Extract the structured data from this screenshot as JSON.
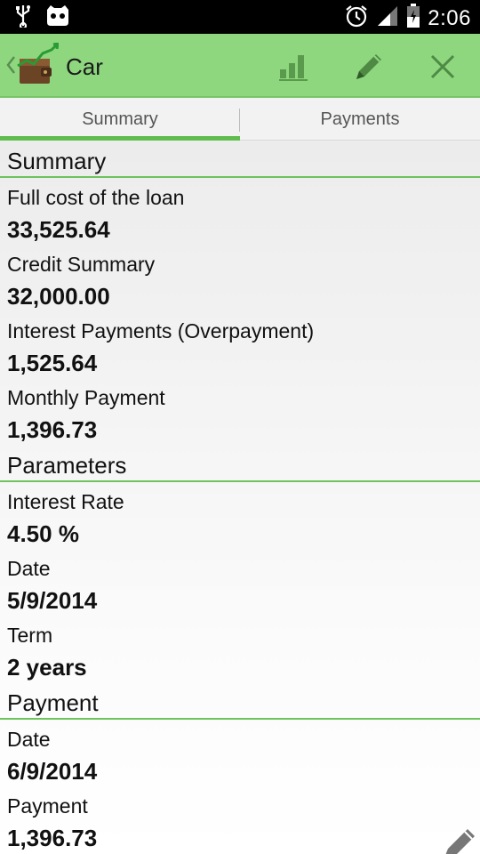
{
  "status_bar": {
    "time": "2:06",
    "icons": [
      "usb-icon",
      "android-icon",
      "alarm-icon",
      "signal-icon",
      "battery-icon"
    ]
  },
  "action_bar": {
    "title": "Car",
    "background_color": "#8ed77f",
    "actions": [
      "chart-icon",
      "edit-icon",
      "close-icon"
    ]
  },
  "tabs": [
    {
      "label": "Summary",
      "selected": true
    },
    {
      "label": "Payments",
      "selected": false
    }
  ],
  "sections": {
    "summary": {
      "header": "Summary",
      "fields": [
        {
          "label": "Full cost of the loan",
          "value": "33,525.64"
        },
        {
          "label": "Credit Summary",
          "value": "32,000.00"
        },
        {
          "label": "Interest Payments (Overpayment)",
          "value": "1,525.64"
        },
        {
          "label": "Monthly Payment",
          "value": "1,396.73"
        }
      ]
    },
    "parameters": {
      "header": "Parameters",
      "fields": [
        {
          "label": "Interest Rate",
          "value": "4.50 %"
        },
        {
          "label": "Date",
          "value": "5/9/2014"
        },
        {
          "label": "Term",
          "value": "2 years"
        }
      ]
    },
    "payment": {
      "header": "Payment",
      "fields": [
        {
          "label": "Date",
          "value": "6/9/2014"
        },
        {
          "label": "Payment",
          "value": "1,396.73"
        }
      ]
    }
  },
  "accent_color": "#5ebd4c"
}
